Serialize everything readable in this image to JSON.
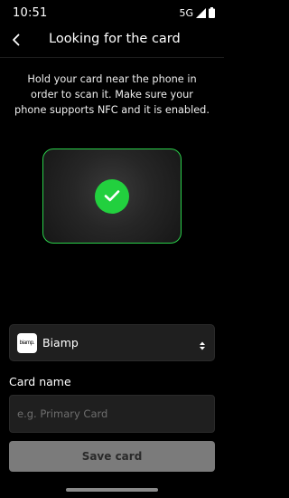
{
  "status_bar": {
    "time": "10:51",
    "network": "5G"
  },
  "header": {
    "title": "Looking for the card",
    "back_icon": "chevron-left-icon"
  },
  "instructions": "Hold your card near the phone in order to scan it. Make sure your phone supports NFC and it is enabled.",
  "scan": {
    "status_icon": "checkmark-icon",
    "accent_color": "#22d03e"
  },
  "provider": {
    "logo_text": "biamp.",
    "selected": "Biamp"
  },
  "card_name": {
    "label": "Card name",
    "value": "",
    "placeholder": "e.g. Primary Card"
  },
  "actions": {
    "save_label": "Save card"
  }
}
